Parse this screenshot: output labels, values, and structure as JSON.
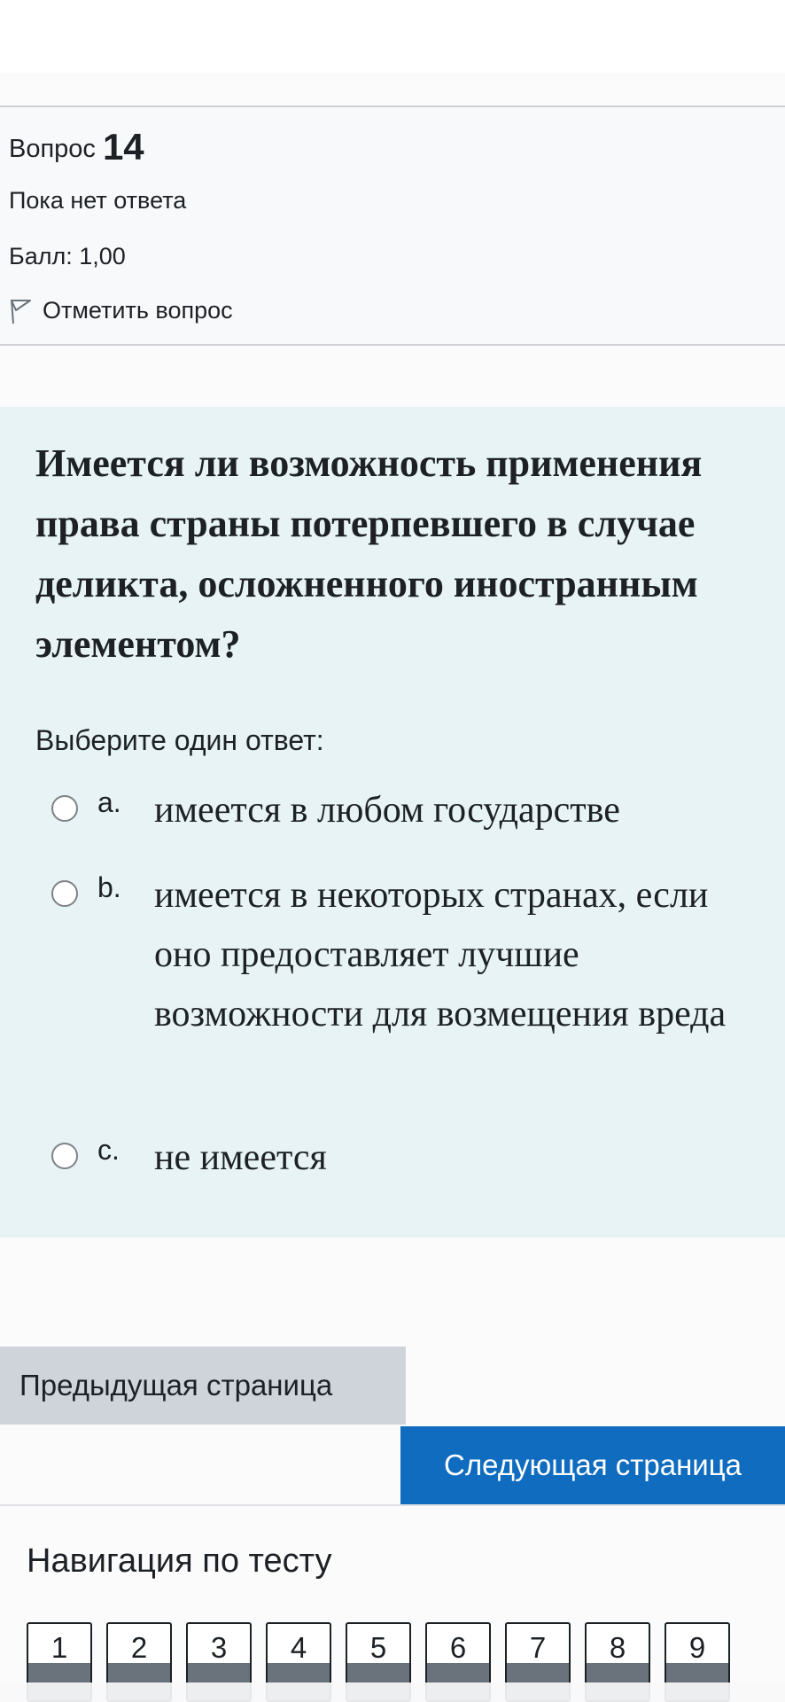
{
  "question_info": {
    "label": "Вопрос",
    "number": "14",
    "state": "Пока нет ответа",
    "grade": "Балл: 1,00",
    "flag_label": "Отметить вопрос"
  },
  "question": {
    "text": "Имеется ли возможность применения права страны потерпевшего в случае деликта, осложненного иностранным элементом?",
    "prompt": "Выберите один ответ:",
    "answers": [
      {
        "letter": "a.",
        "text": "имеется в любом государстве",
        "selected": false
      },
      {
        "letter": "b.",
        "text": "имеется в некоторых странах, если оно предоставляет лучшие возможности для возмещения вреда",
        "selected": false
      },
      {
        "letter": "c.",
        "text": "не имеется",
        "selected": false
      }
    ]
  },
  "navigation": {
    "prev_label": "Предыдущая страница",
    "next_label": "Следующая страница",
    "title": "Навигация по тесту",
    "pages": [
      "1",
      "2",
      "3",
      "4",
      "5",
      "6",
      "7",
      "8",
      "9"
    ]
  },
  "icons": {
    "flag": "flag-icon",
    "radio": "radio-button-icon"
  },
  "colors": {
    "primary": "#0f6cbf",
    "secondary": "#ced4da",
    "formulation_bg": "#e7f3f5",
    "nav_stripe": "#6a737b"
  }
}
